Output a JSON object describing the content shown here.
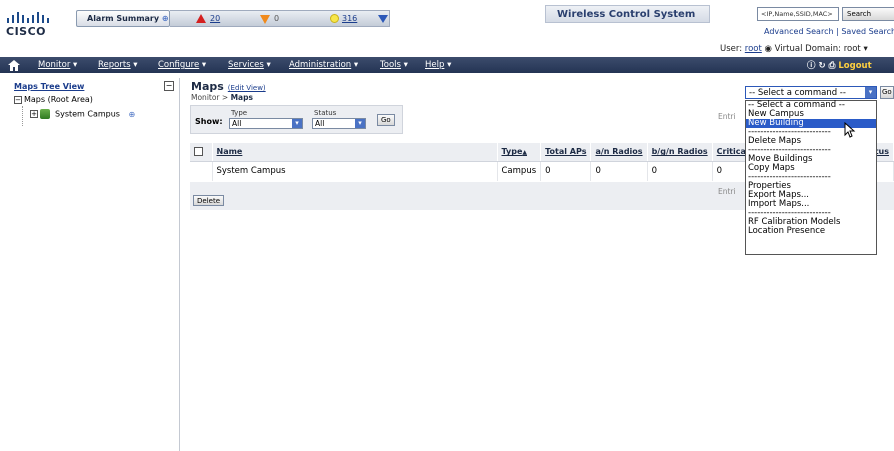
{
  "header": {
    "logo_text": "cisco",
    "alarm_label": "Alarm Summary",
    "alarm_critical": "20",
    "alarm_major": "0",
    "alarm_minor": "316",
    "app_title": "Wireless Control System",
    "search_placeholder": "<IP,Name,SSID,MAC>",
    "search_button": "Search",
    "advanced_search": "Advanced Search",
    "saved_search": "Saved Search",
    "user_label": "User:",
    "user_name": "root",
    "virtual_domain_label": "Virtual Domain:",
    "virtual_domain": "root"
  },
  "nav": {
    "items": [
      "Monitor",
      "Reports",
      "Configure",
      "Services",
      "Administration",
      "Tools",
      "Help"
    ],
    "logout": "Logout"
  },
  "sidebar": {
    "title": "Maps Tree View",
    "root": "Maps (Root Area)",
    "child": "System Campus"
  },
  "main": {
    "title": "Maps",
    "edit_view": "(Edit View)",
    "breadcrumb_parent": "Monitor",
    "breadcrumb_sep": ">",
    "breadcrumb_current": "Maps",
    "show_label": "Show:",
    "type_label": "Type",
    "type_value": "All",
    "status_label": "Status",
    "status_value": "All",
    "go_label": "Go",
    "entries_label": "Entri",
    "delete_label": "Delete"
  },
  "table": {
    "columns": [
      "Name",
      "Type",
      "Total APs",
      "a/n Radios",
      "b/g/n Radios",
      "Critical"
    ],
    "sort_mark": "▲",
    "status_col_fragment": "tus",
    "rows": [
      [
        "System Campus",
        "Campus",
        "0",
        "0",
        "0",
        "0"
      ]
    ]
  },
  "command": {
    "selected": "-- Select a command --",
    "go": "Go",
    "options": [
      "-- Select a command --",
      "New Campus",
      "New Building",
      "---------------------------",
      "Delete Maps",
      "---------------------------",
      "Move Buildings",
      "Copy Maps",
      "---------------------------",
      "Properties",
      "Export Maps...",
      "Import Maps...",
      "---------------------------",
      "RF Calibration Models",
      "Location Presence"
    ],
    "highlighted_index": 2
  },
  "colors": {
    "nav_bg": "#2f3f5f",
    "link": "#1a3c8c",
    "highlight": "#2a5bc8",
    "critical": "#d42020",
    "major": "#f08a1c",
    "minor": "#f7e64a"
  }
}
